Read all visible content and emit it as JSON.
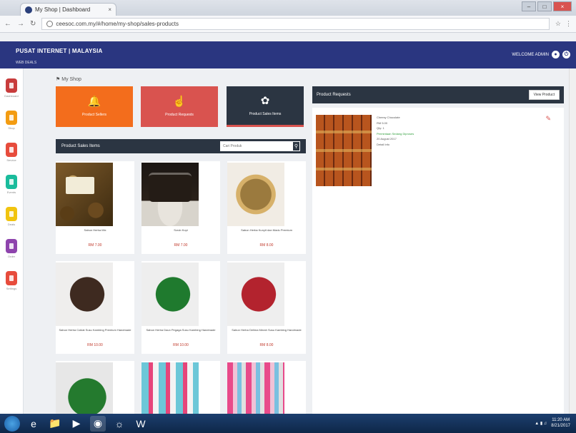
{
  "browser": {
    "tab_title": "My Shop | Dashboard",
    "tab_close": "×",
    "url": "ceesoc.com.my/#/home/my-shop/sales-products",
    "window_controls": [
      "–",
      "□",
      "×"
    ]
  },
  "header": {
    "brand": "PUSAT INTERNET | MALAYSIA",
    "brand_sub": "WEB DEALS",
    "user_link": "WELCOME ADMIN"
  },
  "sidebar": {
    "items": [
      {
        "label": "Dashboard",
        "color": "#c83c3c"
      },
      {
        "label": "Shop",
        "color": "#f39c12"
      },
      {
        "label": "Service",
        "color": "#e74c3c"
      },
      {
        "label": "Events",
        "color": "#1abc9c"
      },
      {
        "label": "Deals",
        "color": "#f1c40f"
      },
      {
        "label": "Order",
        "color": "#8e44ad"
      },
      {
        "label": "Settings",
        "color": "#e74c3c"
      }
    ]
  },
  "breadcrumb": "My Shop",
  "stats": [
    {
      "label": "Product Sellers",
      "icon": "bell-icon"
    },
    {
      "label": "Product Requests",
      "icon": "hand-icon"
    },
    {
      "label": "Product Sales Items",
      "icon": "cubes-icon"
    }
  ],
  "products_panel": {
    "title": "Product Sales Items",
    "search_placeholder": "Cari Produk",
    "items": [
      {
        "name": "Sabun Herba Mix",
        "price": "RM 7.00"
      },
      {
        "name": "Scrub Kopi",
        "price": "RM 7.00"
      },
      {
        "name": "Sabun Herba Kunyit dan Madu Premium",
        "price": "RM 8.00"
      },
      {
        "name": "Sabun Herba Coklat Susu Kambing Premium Handmade",
        "price": "RM 10.00"
      },
      {
        "name": "Sabun Herba Daun Pegaga Susu Kambing Handmade",
        "price": "RM 10.00"
      },
      {
        "name": "Sabun Herba Delima Merah Susu Kambing Handmade",
        "price": "RM 8.00"
      },
      {
        "name": "",
        "price": ""
      },
      {
        "name": "",
        "price": ""
      },
      {
        "name": "",
        "price": ""
      }
    ]
  },
  "requests_panel": {
    "title": "Product Requests",
    "view_button": "View Product",
    "item": {
      "name": "Cheesy Chocolate",
      "price": "RM 5.00",
      "qty": "Qty: 1",
      "status": "Permintaan Sedang Diproses",
      "date": "20 August 2017",
      "note": "Detail Info"
    }
  },
  "taskbar": {
    "apps": [
      "start",
      "ie-icon",
      "explorer-icon",
      "media-icon",
      "chrome-icon",
      "firefox-icon",
      "word-icon"
    ],
    "time": "11:20 AM",
    "date": "8/21/2017"
  },
  "colors": {
    "header": "#2a3680",
    "panel_dark": "#2b3542",
    "orange": "#f36d1c",
    "red": "#d9534f",
    "price": "#c0392b"
  }
}
